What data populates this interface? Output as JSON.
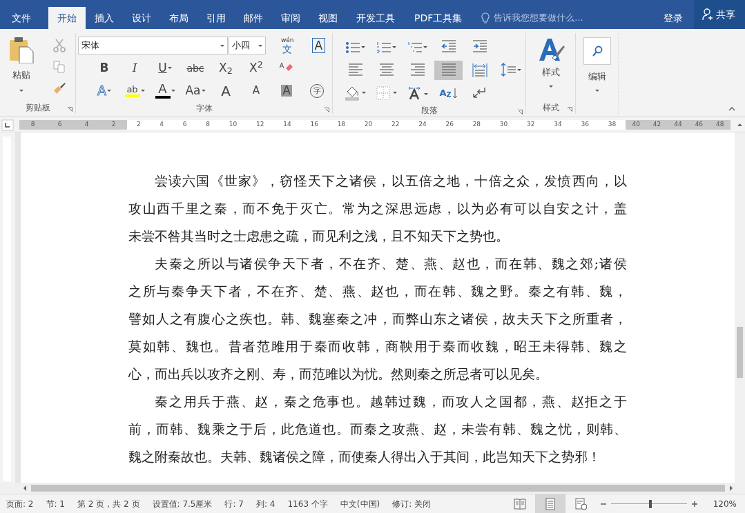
{
  "tabs": [
    {
      "label": "文件",
      "selected": false
    },
    {
      "label": "开始",
      "selected": true
    },
    {
      "label": "插入",
      "selected": false
    },
    {
      "label": "设计",
      "selected": false
    },
    {
      "label": "布局",
      "selected": false
    },
    {
      "label": "引用",
      "selected": false
    },
    {
      "label": "邮件",
      "selected": false
    },
    {
      "label": "审阅",
      "selected": false
    },
    {
      "label": "视图",
      "selected": false
    },
    {
      "label": "开发工具",
      "selected": false
    },
    {
      "label": "PDF工具集",
      "selected": false
    }
  ],
  "tell_me": {
    "placeholder": "告诉我您想要做什么..."
  },
  "sign_in": "登录",
  "share": "共享",
  "clipboard": {
    "paste": "粘贴",
    "label": "剪贴板"
  },
  "font": {
    "name": "宋体",
    "size": "小四",
    "label": "字体",
    "pinyin_top": "wén",
    "pinyin_bottom": "文",
    "border_glyph": "A",
    "row2": [
      {
        "kind": "bold",
        "glyph": "B"
      },
      {
        "kind": "italic",
        "glyph": "I"
      },
      {
        "kind": "underline",
        "glyph": "U"
      },
      {
        "kind": "strike",
        "glyph": "abc"
      },
      {
        "kind": "script",
        "glyph": "X$_{2}$"
      },
      {
        "kind": "script",
        "glyph": "X$^{2}$"
      },
      {
        "kind": "eraser"
      }
    ],
    "row3": [
      {
        "kind": "effects",
        "glyph": "A"
      },
      {
        "kind": "highlight",
        "glyph": "ab",
        "color": "#ffff00"
      },
      {
        "kind": "fontcolor",
        "glyph": "A",
        "color": "#000000"
      },
      {
        "kind": "case",
        "glyph": "Aa"
      },
      {
        "kind": "grow",
        "glyph": "A"
      },
      {
        "kind": "shrink",
        "glyph": "A"
      },
      {
        "kind": "shade",
        "glyph": "A"
      },
      {
        "kind": "enclose",
        "glyph": "字"
      }
    ]
  },
  "paragraph": {
    "label": "段落",
    "row1": [
      {
        "kind": "bullets"
      },
      {
        "kind": "numbering"
      },
      {
        "kind": "multilevel"
      },
      {
        "kind": "outdent"
      },
      {
        "kind": "indent"
      }
    ],
    "row2": [
      {
        "kind": "left",
        "selected": false
      },
      {
        "kind": "center",
        "selected": false
      },
      {
        "kind": "right",
        "selected": false
      },
      {
        "kind": "justify",
        "selected": true
      },
      {
        "kind": "distribute",
        "selected": false
      },
      {
        "kind": "spacing",
        "selected": false
      }
    ],
    "row3": [
      {
        "kind": "shading"
      },
      {
        "kind": "borders"
      },
      {
        "kind": "asian"
      },
      {
        "kind": "sort",
        "glyph": "A$_{Z}$"
      },
      {
        "kind": "marks"
      }
    ]
  },
  "styles": {
    "button": "样式",
    "label": "样式"
  },
  "editing": {
    "button": "编辑"
  },
  "ruler": {
    "left_numbers": [
      "8",
      "6",
      "4",
      "2"
    ],
    "numbers": [
      "2",
      "4",
      "6",
      "8",
      "10",
      "12",
      "14",
      "16",
      "18",
      "20",
      "22",
      "24",
      "26",
      "28",
      "30",
      "32",
      "34",
      "36",
      "38"
    ],
    "right_numbers": [
      "40",
      "42",
      "44",
      "46",
      "48"
    ]
  },
  "document": {
    "paragraphs": [
      {
        "lines": [
          "尝读六国《世家》，窃怪天下之诸侯，以五倍之地，十倍之众，发愤西向，以",
          "攻山西千里之秦，而不免于灭亡。常为之深思远虑，以为必有可以自安之计，盖",
          "未尝不咎其当时之士虑患之疏，而见利之浅，且不知天下之势也。"
        ]
      },
      {
        "lines": [
          "夫秦之所以与诸侯争天下者，不在齐、楚、燕、赵也，而在韩、魏之郊;诸侯",
          "之所与秦争天下者，不在齐、楚、燕、赵也，而在韩、魏之野。秦之有韩、魏，",
          "譬如人之有腹心之疾也。韩、魏塞秦之冲，而弊山东之诸侯，故夫天下之所重者，",
          "莫如韩、魏也。昔者范雎用于秦而收韩，商鞅用于秦而收魏，昭王未得韩、魏之",
          "心，而出兵以攻齐之刚、寿，而范雎以为忧。然则秦之所忌者可以见矣。"
        ]
      },
      {
        "lines": [
          "秦之用兵于燕、赵，秦之危事也。越韩过魏，而攻人之国都，燕、赵拒之于",
          "前，而韩、魏乘之于后，此危道也。而秦之攻燕、赵，未尝有韩、魏之忧，则韩、",
          "魏之附秦故也。夫韩、魏诸侯之障，而使秦人得出入于其间，此岂知天下之势邪！"
        ]
      }
    ]
  },
  "status_bar": {
    "items": [
      "页面: 2",
      "节: 1",
      "第 2 页，共 2 页",
      "设置值: 7.5厘米",
      "行: 7",
      "列: 4",
      "1163 个字",
      "中文(中国)",
      "修订: 关闭"
    ],
    "views": [
      {
        "kind": "read",
        "selected": false
      },
      {
        "kind": "print",
        "selected": true
      },
      {
        "kind": "web",
        "selected": false
      }
    ],
    "zoom": {
      "level": 0.52,
      "reading": "120%"
    }
  }
}
